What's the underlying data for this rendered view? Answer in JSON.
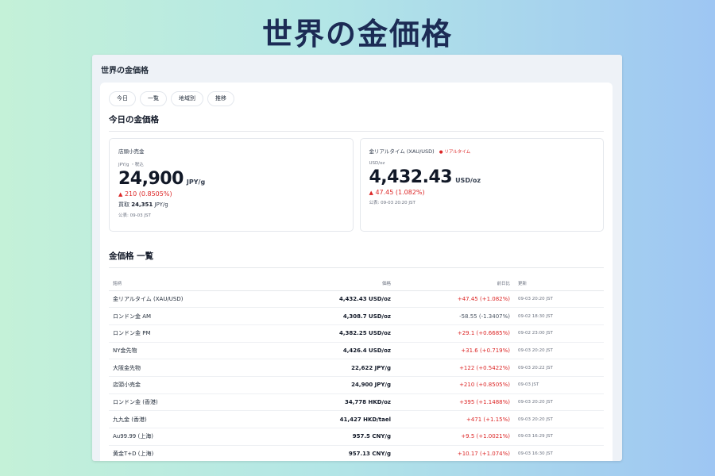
{
  "page": {
    "title": "世界の金価格"
  },
  "window": {
    "title": "世界の金価格"
  },
  "tabs": [
    {
      "label": "今日"
    },
    {
      "label": "一覧"
    },
    {
      "label": "地域別"
    },
    {
      "label": "推移"
    }
  ],
  "today": {
    "title": "今日の金価格",
    "retail": {
      "label": "店頭小売金",
      "unit_note": "JPY/g ・税込",
      "price": "24,900",
      "unit": "JPY/g",
      "change": "210 (0.8505%)",
      "buy_label": "買取",
      "buy_value": "24,351",
      "buy_unit": "JPY/g",
      "published": "公表: 09-03 JST"
    },
    "realtime": {
      "label": "金リアルタイム (XAU/USD)",
      "live_badge": "● リアルタイム",
      "unit_note": "USD/oz",
      "price": "4,432.43",
      "unit": "USD/oz",
      "change": "47.45 (1.082%)",
      "published": "公表: 09-03 20:20 JST"
    },
    "up_arrow": "▲"
  },
  "list": {
    "title": "金価格 一覧",
    "columns": {
      "name": "銘柄",
      "price": "価格",
      "change": "前日比",
      "updated": "更新"
    },
    "rows": [
      {
        "name": "金リアルタイム (XAU/USD)",
        "price": "4,432.43 USD/oz",
        "change": "+47.45 (+1.082%)",
        "updated": "09-03 20:20 JST"
      },
      {
        "name": "ロンドン金 AM",
        "price": "4,308.7 USD/oz",
        "change": "-58.55 (-1.3407%)",
        "updated": "09-02 18:30 JST"
      },
      {
        "name": "ロンドン金 PM",
        "price": "4,382.25 USD/oz",
        "change": "+29.1 (+0.6685%)",
        "updated": "09-02 23:00 JST"
      },
      {
        "name": "NY金先物",
        "price": "4,426.4 USD/oz",
        "change": "+31.6 (+0.719%)",
        "updated": "09-03 20:20 JST"
      },
      {
        "name": "大阪金先物",
        "price": "22,622 JPY/g",
        "change": "+122 (+0.5422%)",
        "updated": "09-03 20:22 JST"
      },
      {
        "name": "店頭小売金",
        "price": "24,900 JPY/g",
        "change": "+210 (+0.8505%)",
        "updated": "09-03 JST"
      },
      {
        "name": "ロンドン金 (香港)",
        "price": "34,778 HKD/oz",
        "change": "+395 (+1.1488%)",
        "updated": "09-03 20:20 JST"
      },
      {
        "name": "九九金 (香港)",
        "price": "41,427 HKD/tael",
        "change": "+471 (+1.15%)",
        "updated": "09-03 20:20 JST"
      },
      {
        "name": "Au99.99 (上海)",
        "price": "957.5 CNY/g",
        "change": "+9.5 (+1.0021%)",
        "updated": "09-03 16:29 JST"
      },
      {
        "name": "黄金T+D (上海)",
        "price": "957.13 CNY/g",
        "change": "+10.17 (+1.074%)",
        "updated": "09-03 16:30 JST"
      }
    ]
  }
}
